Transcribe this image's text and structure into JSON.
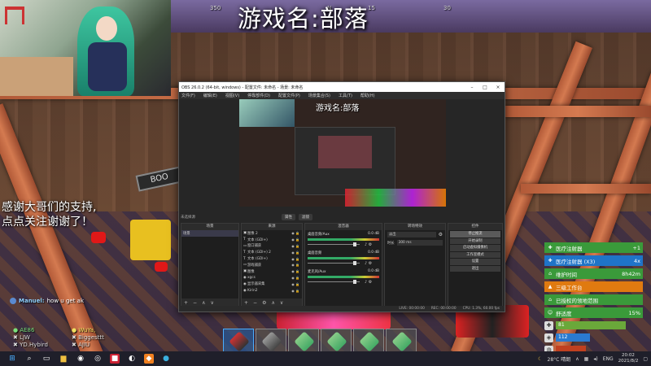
{
  "overlay": {
    "game_title": "游戏名:部落",
    "compass": [
      "350",
      "N",
      "15",
      "30"
    ],
    "thanks_line1": "感谢大哥们的支持,",
    "thanks_line2": "点点关注谢谢了！",
    "sign": "BOO"
  },
  "chat": {
    "message": {
      "user": "Manuel:",
      "text": "how u get ak"
    },
    "viewers": [
      {
        "name": "AE86",
        "color": "green"
      },
      {
        "name": "WuYa,",
        "color": "yellow"
      },
      {
        "name": "LJW",
        "color": "white"
      },
      {
        "name": "Biggesttt",
        "color": "white"
      },
      {
        "name": "YD.Hybird",
        "color": "white"
      },
      {
        "name": "AJIU",
        "color": "white"
      }
    ]
  },
  "obs": {
    "title": "OBS 26.0.2 (64-bit, windows) - 配置文件: 未命名 - 场景: 未命名",
    "menu": [
      "文件(F)",
      "编辑(E)",
      "视图(V)",
      "停靠部件(D)",
      "配置文件(P)",
      "场景集合(S)",
      "工具(T)",
      "帮助(H)"
    ],
    "preview_title": "游戏名:部落",
    "scene_label": "未选择源",
    "tabs": [
      "属性",
      "滤镜"
    ],
    "scenes_header": "场景",
    "scenes": [
      "场景"
    ],
    "sources_header": "来源",
    "sources": [
      {
        "icon": "▣",
        "name": "图像 2"
      },
      {
        "icon": "T",
        "name": "文本 (GDI+)"
      },
      {
        "icon": "▭",
        "name": "窗口捕获"
      },
      {
        "icon": "T",
        "name": "文本 (GDI+) 2"
      },
      {
        "icon": "T",
        "name": "文本 (GDI+)"
      },
      {
        "icon": "▭",
        "name": "游戏捕获"
      },
      {
        "icon": "▣",
        "name": "图像"
      },
      {
        "icon": "◉",
        "name": "xgcs"
      },
      {
        "icon": "◉",
        "name": "显示器采集"
      },
      {
        "icon": "◉",
        "name": "Kirin2"
      }
    ],
    "mixer_header": "混音器",
    "mixer": [
      {
        "name": "桌面音频/Aux",
        "db": "0.0 dB"
      },
      {
        "name": "桌面音频",
        "db": "0.0 dB"
      },
      {
        "name": "麦克风/Aux",
        "db": "0.0 dB"
      }
    ],
    "transitions_header": "转场特效",
    "transition": "淡出",
    "duration_label": "时长",
    "duration": "300 ms",
    "controls_header": "控件",
    "controls": [
      "停止推流",
      "开始录制",
      "启动虚拟摄像机",
      "工作室模式",
      "设置",
      "退出"
    ],
    "status": [
      "LIVE: 00:00:00",
      "REC: 00:00:00",
      "CPU: 1.3%, 60.00 fps"
    ]
  },
  "hud": {
    "tasks": [
      {
        "icon": "✚",
        "label": "医疗注射器",
        "right": "+1",
        "style": "green"
      },
      {
        "icon": "✚",
        "label": "医疗注射器 (X3)",
        "right": "4x",
        "style": "blue"
      },
      {
        "icon": "⌂",
        "label": "维护时间",
        "right": "8h42m",
        "style": "green"
      },
      {
        "icon": "▲",
        "label": "三级工作台",
        "right": "",
        "style": "orange"
      },
      {
        "icon": "⌂",
        "label": "已授权的领地范围",
        "right": "",
        "style": "green"
      },
      {
        "icon": "☺",
        "label": "舒适度",
        "right": "15%",
        "style": "green"
      }
    ],
    "stats": [
      {
        "icon": "✚",
        "value": "81",
        "fill": 0.81,
        "color": "#6aa83a"
      },
      {
        "icon": "◈",
        "value": "112",
        "fill": 0.4,
        "color": "#2a7ad0"
      },
      {
        "icon": "◍",
        "value": "",
        "fill": 0.35,
        "color": "#c04020"
      }
    ]
  },
  "taskbar": {
    "weather": "28°C 晴朗",
    "lang": "ENG",
    "time": "20:02",
    "date": "2021/8/2"
  }
}
